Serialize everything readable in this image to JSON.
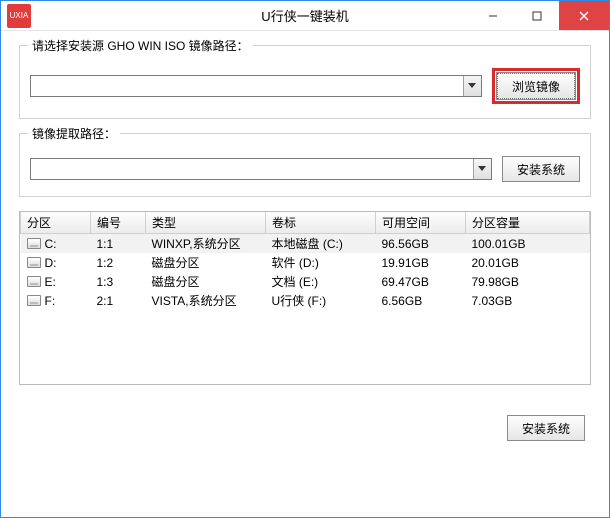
{
  "window": {
    "title": "U行侠一键装机",
    "icon_label": "UXIA"
  },
  "group1": {
    "title": "请选择安装源 GHO WIN ISO 镜像路径：",
    "source_value": "",
    "browse_label": "浏览镜像"
  },
  "group2": {
    "title": "镜像提取路径：",
    "extract_value": "",
    "install_label": "安装系统"
  },
  "table": {
    "headers": {
      "part": "分区",
      "num": "编号",
      "type": "类型",
      "label": "卷标",
      "free": "可用空间",
      "cap": "分区容量"
    },
    "rows": [
      {
        "part": "C:",
        "num": "1:1",
        "type": "WINXP,系统分区",
        "label": "本地磁盘 (C:)",
        "free": "96.56GB",
        "cap": "100.01GB"
      },
      {
        "part": "D:",
        "num": "1:2",
        "type": "磁盘分区",
        "label": "软件 (D:)",
        "free": "19.91GB",
        "cap": "20.01GB"
      },
      {
        "part": "E:",
        "num": "1:3",
        "type": "磁盘分区",
        "label": "文档 (E:)",
        "free": "69.47GB",
        "cap": "79.98GB"
      },
      {
        "part": "F:",
        "num": "2:1",
        "type": "VISTA,系统分区",
        "label": "U行侠 (F:)",
        "free": "6.56GB",
        "cap": "7.03GB"
      }
    ]
  },
  "bottom": {
    "install_label": "安装系统"
  }
}
